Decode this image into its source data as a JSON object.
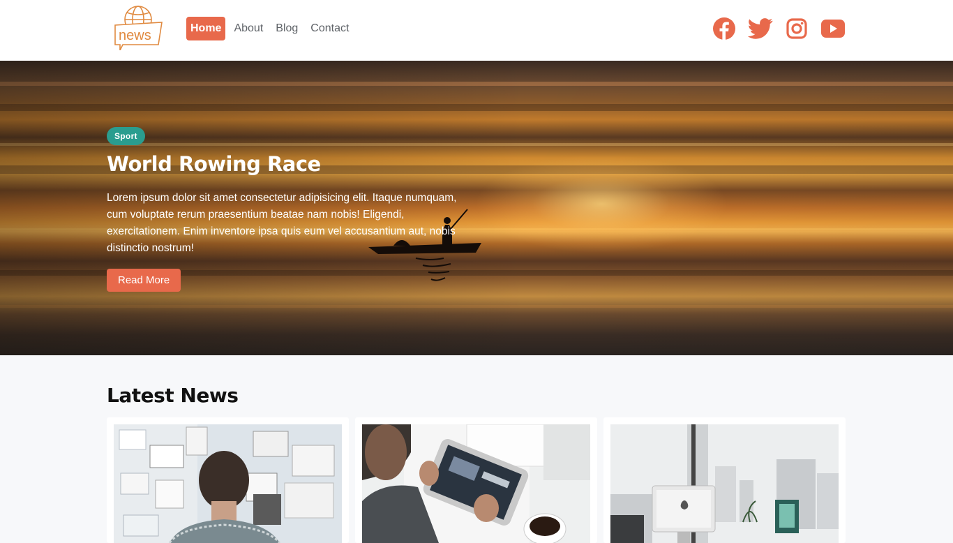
{
  "header": {
    "logo_text": "news",
    "nav": [
      {
        "label": "Home",
        "active": true
      },
      {
        "label": "About",
        "active": false
      },
      {
        "label": "Blog",
        "active": false
      },
      {
        "label": "Contact",
        "active": false
      }
    ],
    "socials": [
      "facebook-icon",
      "twitter-icon",
      "instagram-icon",
      "youtube-icon"
    ],
    "accent_color": "#e8694b"
  },
  "hero": {
    "tag": "Sport",
    "tag_color": "#2a9d8f",
    "title": "World Rowing Race",
    "text": "Lorem ipsum dolor sit amet consectetur adipisicing elit. Itaque numquam, cum voluptate rerum praesentium beatae nam nobis! Eligendi, exercitationem. Enim inventore ipsa quis eum vel accusantium aut, nobis distinctio nostrum!",
    "button": "Read More"
  },
  "latest": {
    "title": "Latest News",
    "cards": [
      {
        "image": "person-viewing-wall-of-notes"
      },
      {
        "image": "person-using-tablet-with-coffee"
      },
      {
        "image": "office-desk-with-imac-and-city-view"
      }
    ]
  }
}
